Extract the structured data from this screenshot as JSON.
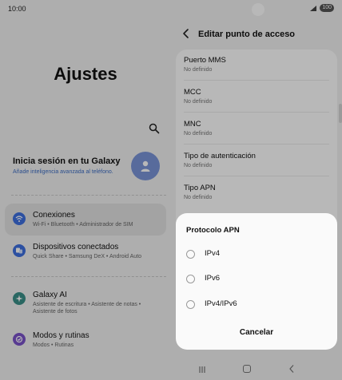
{
  "status": {
    "time": "10:00",
    "battery": "100"
  },
  "left": {
    "title": "Ajustes",
    "account": {
      "title": "Inicia sesión en tu Galaxy",
      "subtitle": "Añade inteligencia avanzada al teléfono."
    },
    "items": [
      {
        "label": "Conexiones",
        "sub": "Wi-Fi • Bluetooth • Administrador de SIM",
        "icon": "wifi-icon",
        "color": "#3d6fe0"
      },
      {
        "label": "Dispositivos conectados",
        "sub": "Quick Share • Samsung DeX • Android Auto",
        "icon": "devices-icon",
        "color": "#3d6fe0"
      },
      {
        "label": "Galaxy AI",
        "sub": "Asistente de escritura • Asistente de notas •",
        "sub2": "Asistente de fotos",
        "icon": "ai-sparkle-icon",
        "color": "#3a8f88"
      },
      {
        "label": "Modos y rutinas",
        "sub": "Modos • Rutinas",
        "icon": "modes-icon",
        "color": "#7a52c9"
      }
    ]
  },
  "right": {
    "title": "Editar punto de acceso",
    "rows": [
      {
        "title": "Puerto MMS",
        "value": "No definido"
      },
      {
        "title": "MCC",
        "value": "No definido"
      },
      {
        "title": "MNC",
        "value": "No definido"
      },
      {
        "title": "Tipo de autenticación",
        "value": "No definido"
      },
      {
        "title": "Tipo APN",
        "value": "No definido"
      }
    ]
  },
  "dialog": {
    "title": "Protocolo APN",
    "options": [
      "IPv4",
      "IPv6",
      "IPv4/IPv6"
    ],
    "cancel": "Cancelar"
  }
}
